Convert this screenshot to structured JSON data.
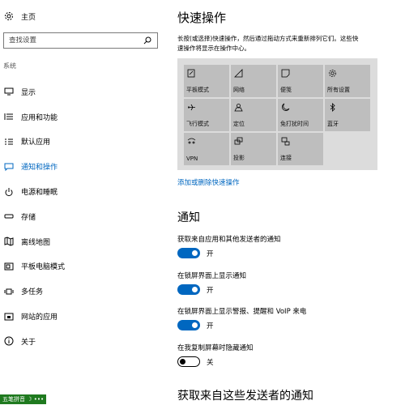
{
  "sidebar": {
    "home_label": "主页",
    "search_placeholder": "查找设置",
    "section_title": "系统",
    "items": [
      {
        "label": "显示",
        "icon": "monitor-icon"
      },
      {
        "label": "应用和功能",
        "icon": "list-icon"
      },
      {
        "label": "默认应用",
        "icon": "default-apps-icon"
      },
      {
        "label": "通知和操作",
        "icon": "message-icon"
      },
      {
        "label": "电源和睡眠",
        "icon": "power-icon"
      },
      {
        "label": "存储",
        "icon": "storage-icon"
      },
      {
        "label": "离线地图",
        "icon": "map-icon"
      },
      {
        "label": "平板电脑模式",
        "icon": "tablet-icon"
      },
      {
        "label": "多任务",
        "icon": "multitask-icon"
      },
      {
        "label": "网站的应用",
        "icon": "web-app-icon"
      },
      {
        "label": "关于",
        "icon": "info-icon"
      }
    ]
  },
  "main": {
    "title": "快速操作",
    "description_line1": "长按(或选择)快速操作，然后通过拖动方式来重新排列它们。这些快",
    "description_line2": "速操作将显示在操作中心。",
    "quick_actions": [
      {
        "label": "平板模式",
        "icon": "tablet-mode-icon"
      },
      {
        "label": "网络",
        "icon": "network-icon"
      },
      {
        "label": "便笺",
        "icon": "note-icon"
      },
      {
        "label": "所有设置",
        "icon": "gear-icon"
      },
      {
        "label": "飞行模式",
        "icon": "airplane-icon"
      },
      {
        "label": "定位",
        "icon": "location-icon"
      },
      {
        "label": "免打扰时间",
        "icon": "moon-icon"
      },
      {
        "label": "蓝牙",
        "icon": "bluetooth-icon"
      },
      {
        "label": "VPN",
        "icon": "vpn-icon"
      },
      {
        "label": "投影",
        "icon": "project-icon"
      },
      {
        "label": "连接",
        "icon": "connect-icon"
      }
    ],
    "add_remove_link": "添加或删除快速操作",
    "notifications_heading": "通知",
    "settings": [
      {
        "label": "获取来自应用和其他发送者的通知",
        "state": "开",
        "on": true
      },
      {
        "label": "在锁屏界面上显示通知",
        "state": "开",
        "on": true
      },
      {
        "label": "在锁屏界面上显示警报、提醒和 VoIP 来电",
        "state": "开",
        "on": true
      },
      {
        "label": "在我复制屏幕时隐藏通知",
        "state": "关",
        "on": false
      }
    ],
    "senders_heading": "获取来自这些发送者的通知"
  },
  "ime_badge": "五笔拼音 ☽ •••",
  "colors": {
    "accent": "#0067c0",
    "tile": "#bebebe",
    "panel": "#dcdcdc"
  }
}
